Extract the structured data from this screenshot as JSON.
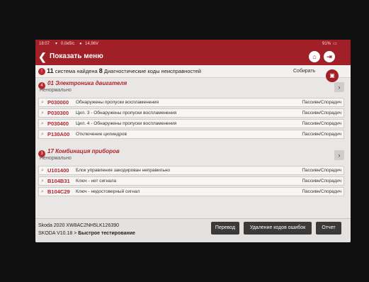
{
  "status_bar": {
    "time": "18:07",
    "speed": "0,0кб/с",
    "voltage": "14,96V",
    "battery": "91%"
  },
  "header": {
    "back_icon": "chevron-left-icon",
    "title": "Показать меню"
  },
  "summary": {
    "systems_count": "11",
    "systems_text": "система найдена",
    "dtc_count": "8",
    "dtc_text": "Диагностические коды неисправностей",
    "collect_label": "Собирать"
  },
  "groups": [
    {
      "badge": "4",
      "title": "01 Электроника двигателя",
      "status": "Ненормально",
      "codes": [
        {
          "code": "P030000",
          "desc": "Обнаружены пропуски воспламенения",
          "status": "Пассивн/Спорадич"
        },
        {
          "code": "P030300",
          "desc": "Цил. 3 - Обнаружены пропуски воспламенения",
          "status": "Пассивн/Спорадич"
        },
        {
          "code": "P030400",
          "desc": "Цил. 4 - Обнаружены пропуски воспламенения",
          "status": "Пассивн/Спорадич"
        },
        {
          "code": "P130A00",
          "desc": "Отключение цилиндров",
          "status": "Пассивн/Спорадич"
        }
      ]
    },
    {
      "badge": "3",
      "title": "17 Комбинация приборов",
      "status": "Ненормально",
      "codes": [
        {
          "code": "U101400",
          "desc": "Блок управления закодирован неправильно",
          "status": "Пассивн/Спорадич"
        },
        {
          "code": "B104B31",
          "desc": "Ключ - нет сигнала",
          "status": "Пассивн/Спорадич"
        },
        {
          "code": "B104C29",
          "desc": "Ключ - недостоверный сигнал",
          "status": "Пассивн/Спорадич"
        }
      ]
    }
  ],
  "footer": {
    "vehicle": "Skoda  2020  XW8AC2NH5LK126390",
    "path_prefix": "SKODA V10.18 > ",
    "path_current": "Быстрое тестирование",
    "btn_translate": "Перевод",
    "btn_clear": "Удаление кодов ошибок",
    "btn_report": "Отчет"
  }
}
